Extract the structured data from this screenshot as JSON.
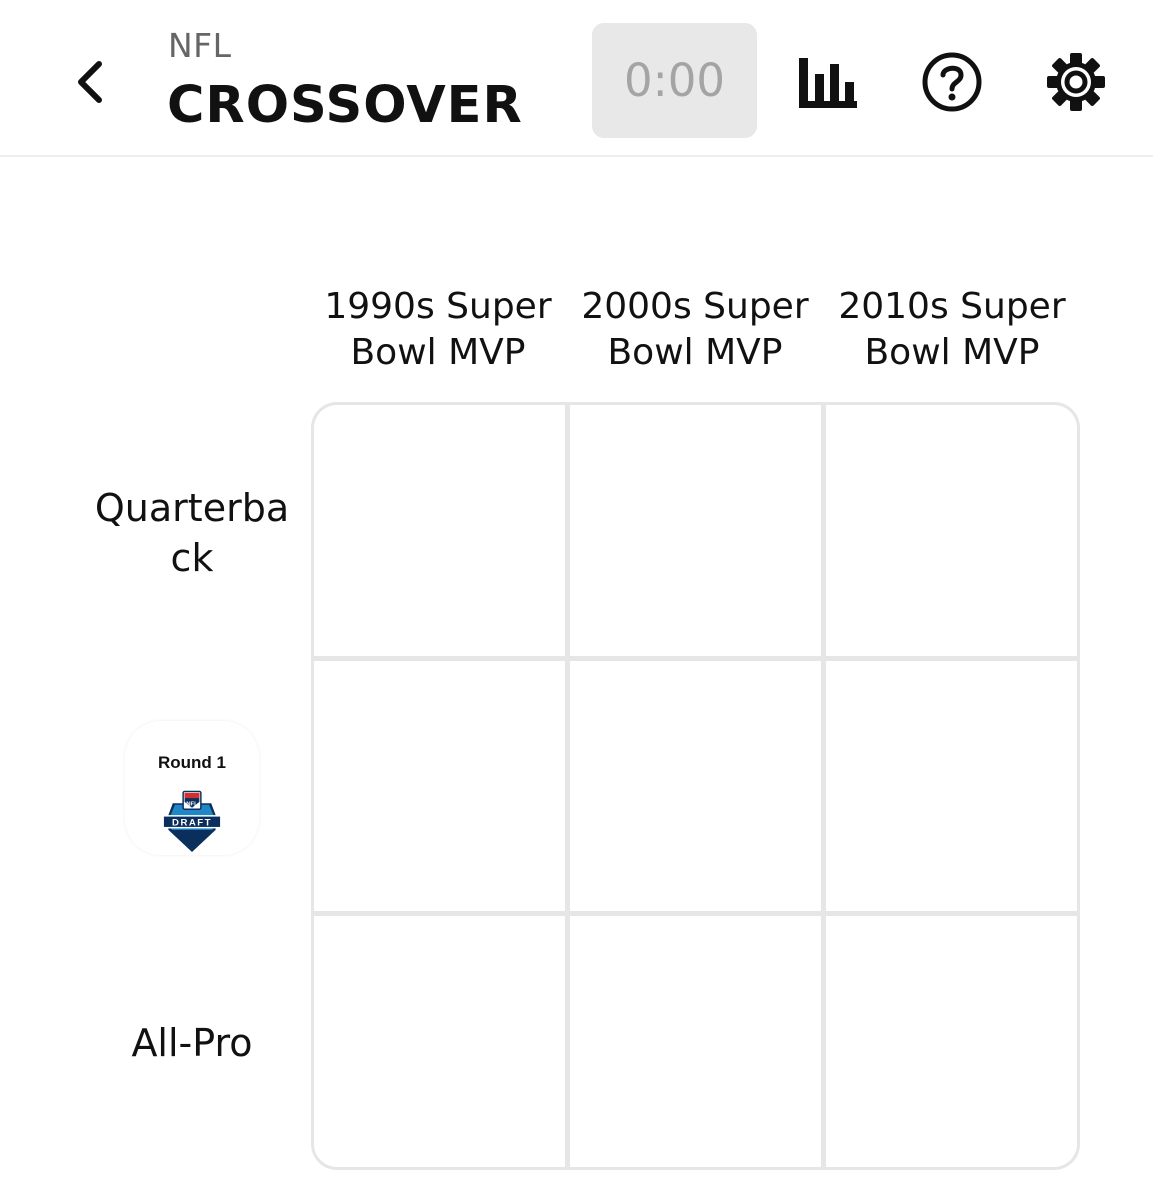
{
  "header": {
    "league": "NFL",
    "title": "CROSSOVER",
    "timer": "0:00",
    "icons": {
      "back": "chevron-left-icon",
      "stats": "bar-chart-icon",
      "help": "question-circle-icon",
      "settings": "gear-icon"
    }
  },
  "columns": [
    {
      "label": "1990s Super Bowl MVP"
    },
    {
      "label": "2000s Super Bowl MVP"
    },
    {
      "label": "2010s Super Bowl MVP"
    }
  ],
  "rows": [
    {
      "label": "Quarterback"
    },
    {
      "label": "Round 1",
      "logo_text": "NFL",
      "logo_band": "DRAFT"
    },
    {
      "label": "All-Pro"
    }
  ],
  "colors": {
    "draft_blue": "#1f87c7",
    "draft_navy": "#0b2f5d",
    "grid_border": "#e6e6e6",
    "timer_bg": "#e8e8e8"
  }
}
